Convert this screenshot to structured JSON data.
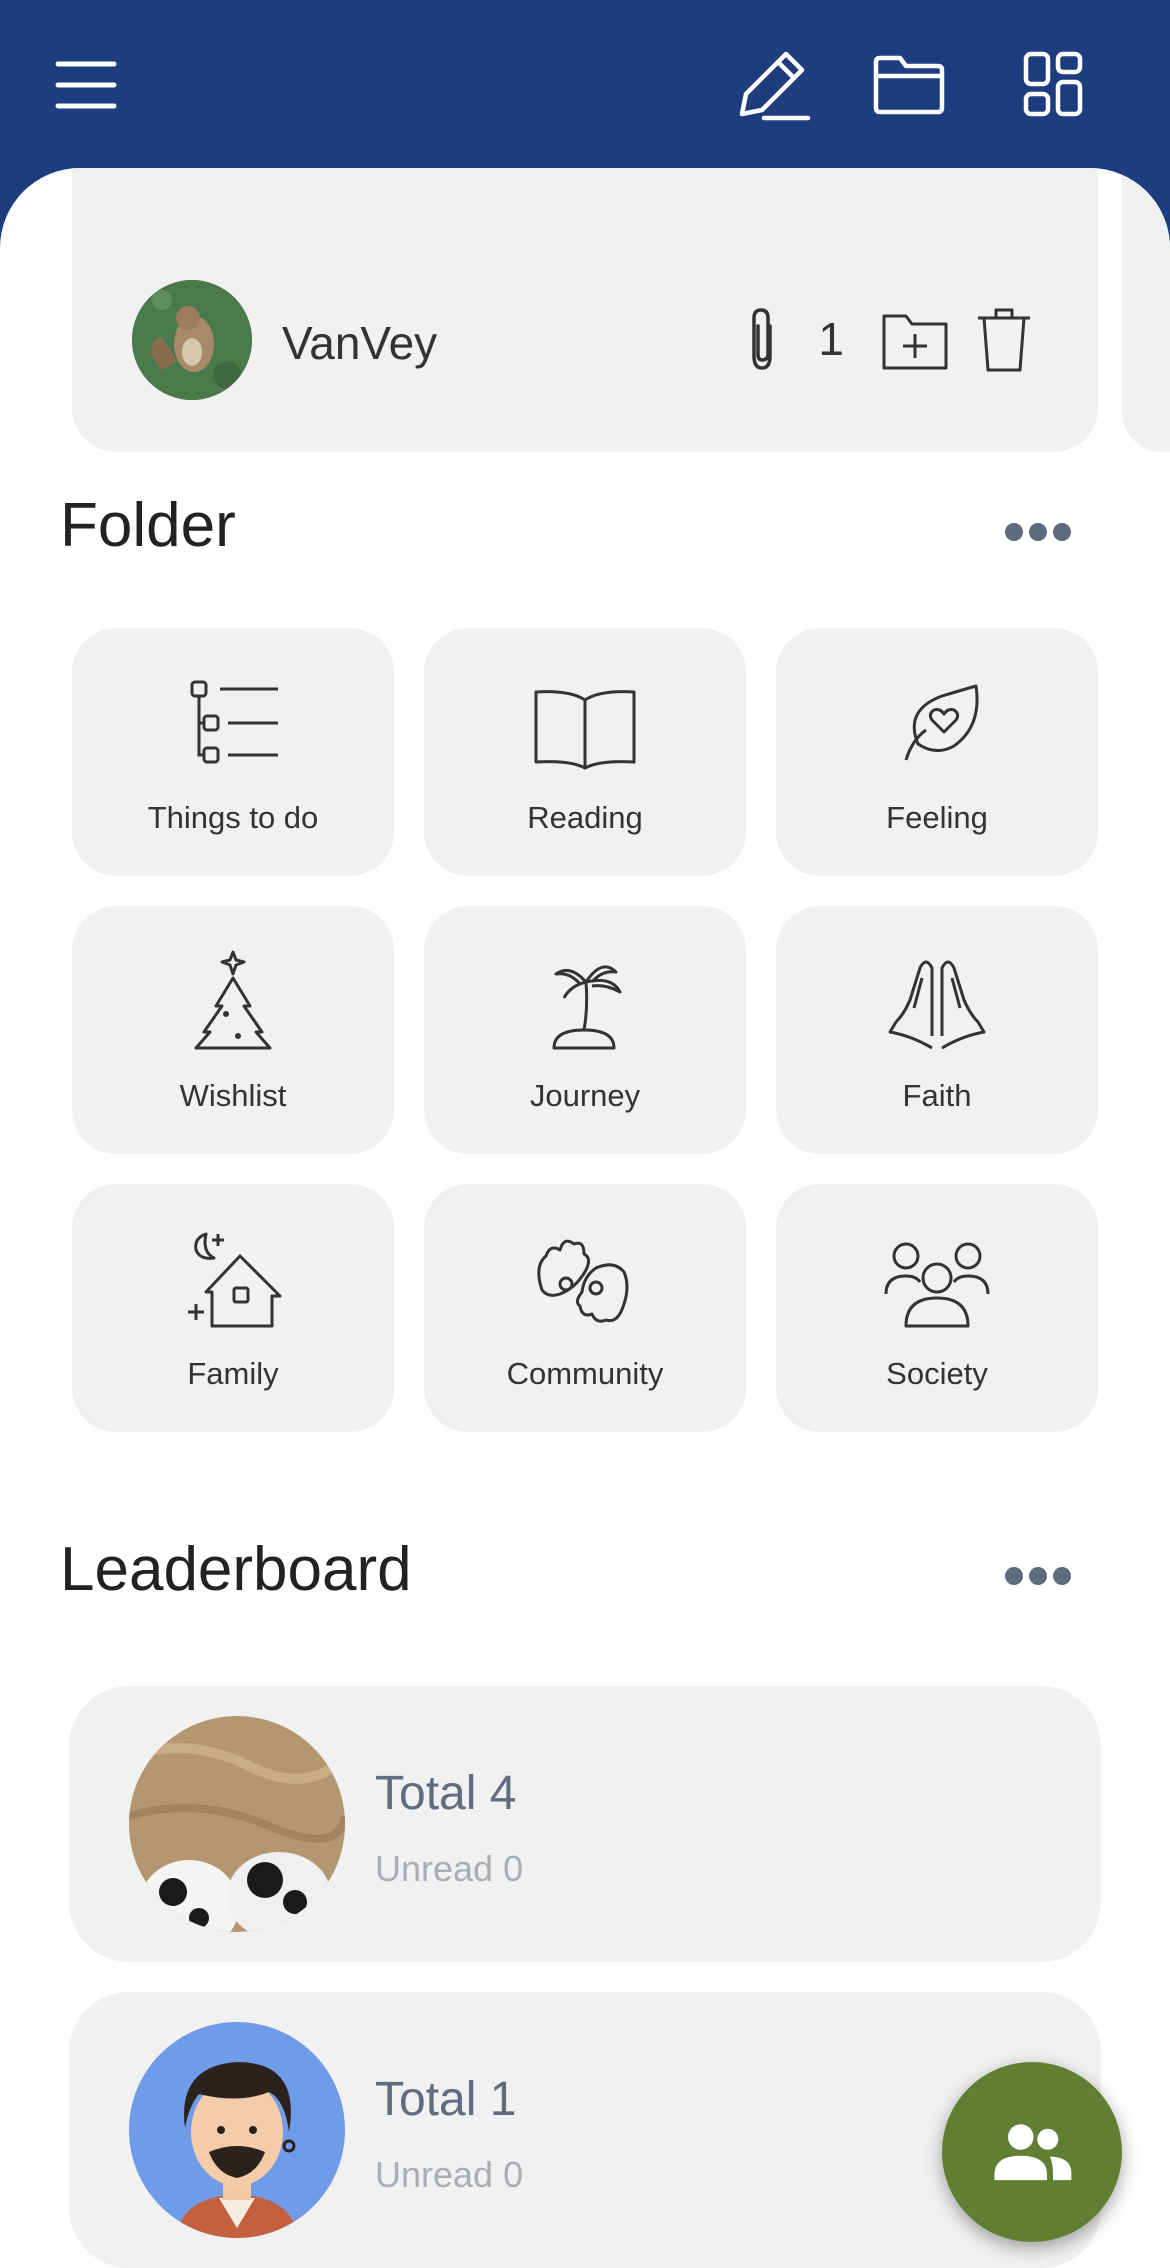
{
  "toolbar": {
    "icons": [
      "menu-icon",
      "pencil-icon",
      "folder-icon",
      "grid-icon"
    ],
    "header_color": "#1e3d7e"
  },
  "note": {
    "user_name": "VanVey",
    "attachment_count": "1",
    "icons": [
      "paperclip-icon",
      "folder-plus-icon",
      "trash-icon"
    ]
  },
  "folder_section": {
    "title": "Folder",
    "items": [
      {
        "label": "Things to do",
        "icon": "task-tree-icon"
      },
      {
        "label": "Reading",
        "icon": "book-icon"
      },
      {
        "label": "Feeling",
        "icon": "heart-leaf-icon"
      },
      {
        "label": "Wishlist",
        "icon": "tree-star-icon"
      },
      {
        "label": "Journey",
        "icon": "palm-island-icon"
      },
      {
        "label": "Faith",
        "icon": "praying-hands-icon"
      },
      {
        "label": "Family",
        "icon": "house-moon-icon"
      },
      {
        "label": "Community",
        "icon": "sign-hands-icon"
      },
      {
        "label": "Society",
        "icon": "people-group-icon"
      }
    ]
  },
  "leaderboard": {
    "title": "Leaderboard",
    "entries": [
      {
        "total": "Total 4",
        "unread": "Unread 0"
      },
      {
        "total": "Total 1",
        "unread": "Unread 0"
      }
    ]
  },
  "fab": {
    "icon": "group-icon",
    "color": "#617f33"
  }
}
